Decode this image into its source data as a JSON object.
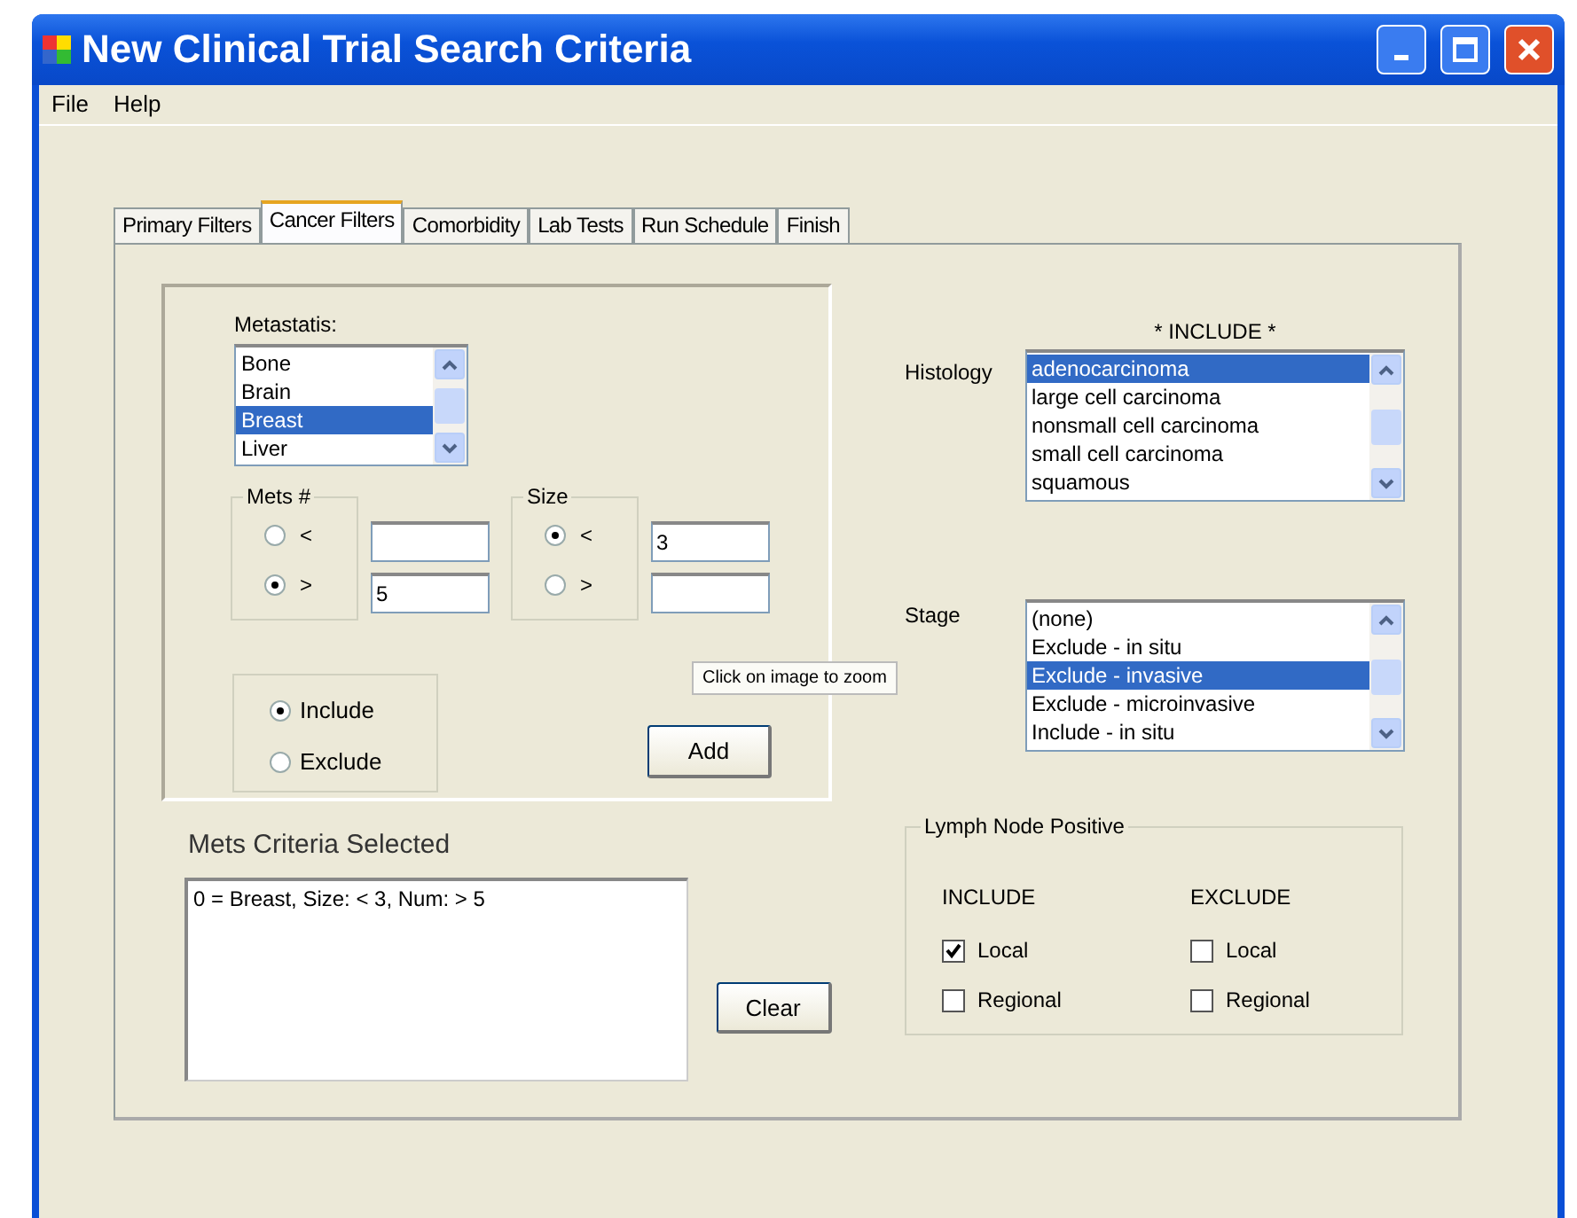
{
  "window": {
    "title": "New Clinical Trial Search Criteria"
  },
  "menu": [
    "File",
    "Help"
  ],
  "tabs": [
    {
      "label": "Primary Filters",
      "selected": false
    },
    {
      "label": "Cancer Filters",
      "selected": true
    },
    {
      "label": "Comorbidity",
      "selected": false
    },
    {
      "label": "Lab Tests",
      "selected": false
    },
    {
      "label": "Run Schedule",
      "selected": false
    },
    {
      "label": "Finish",
      "selected": false
    }
  ],
  "metastasis": {
    "label": "Metastatis:",
    "items": [
      {
        "text": "Bone",
        "selected": false
      },
      {
        "text": "Brain",
        "selected": false
      },
      {
        "text": "Breast",
        "selected": true
      },
      {
        "text": "Liver",
        "selected": false
      }
    ]
  },
  "mets_count": {
    "title": "Mets #",
    "options": [
      {
        "label": "<",
        "selected": false
      },
      {
        "label": ">",
        "selected": true,
        "value": "5"
      }
    ]
  },
  "size": {
    "title": "Size",
    "options": [
      {
        "label": "<",
        "selected": true,
        "value": "3"
      },
      {
        "label": ">",
        "selected": false
      }
    ]
  },
  "mode": {
    "options": [
      {
        "label": "Include",
        "selected": true
      },
      {
        "label": "Exclude",
        "selected": false
      }
    ]
  },
  "add_button": "Add",
  "tooltip": "Click on image to zoom",
  "criteria": {
    "label": "Mets Criteria Selected",
    "items": [
      "0 = Breast, Size: < 3, Num: > 5"
    ]
  },
  "clear_button": "Clear",
  "histology": {
    "header": "* INCLUDE *",
    "label": "Histology",
    "items": [
      {
        "text": "adenocarcinoma",
        "selected": true
      },
      {
        "text": "large cell carcinoma",
        "selected": false
      },
      {
        "text": "nonsmall cell carcinoma",
        "selected": false
      },
      {
        "text": "small cell carcinoma",
        "selected": false
      },
      {
        "text": "squamous",
        "selected": false
      }
    ]
  },
  "stage": {
    "label": "Stage",
    "items": [
      {
        "text": "(none)",
        "selected": false
      },
      {
        "text": "Exclude - in situ",
        "selected": false
      },
      {
        "text": "Exclude - invasive",
        "selected": true
      },
      {
        "text": "Exclude - microinvasive",
        "selected": false
      },
      {
        "text": "Include - in situ",
        "selected": false
      }
    ]
  },
  "lymph_node": {
    "title": "Lymph Node Positive",
    "columns": [
      {
        "heading": "INCLUDE",
        "options": [
          {
            "label": "Local",
            "checked": true
          },
          {
            "label": "Regional",
            "checked": false
          }
        ]
      },
      {
        "heading": "EXCLUDE",
        "options": [
          {
            "label": "Local",
            "checked": false
          },
          {
            "label": "Regional",
            "checked": false
          }
        ]
      }
    ]
  }
}
